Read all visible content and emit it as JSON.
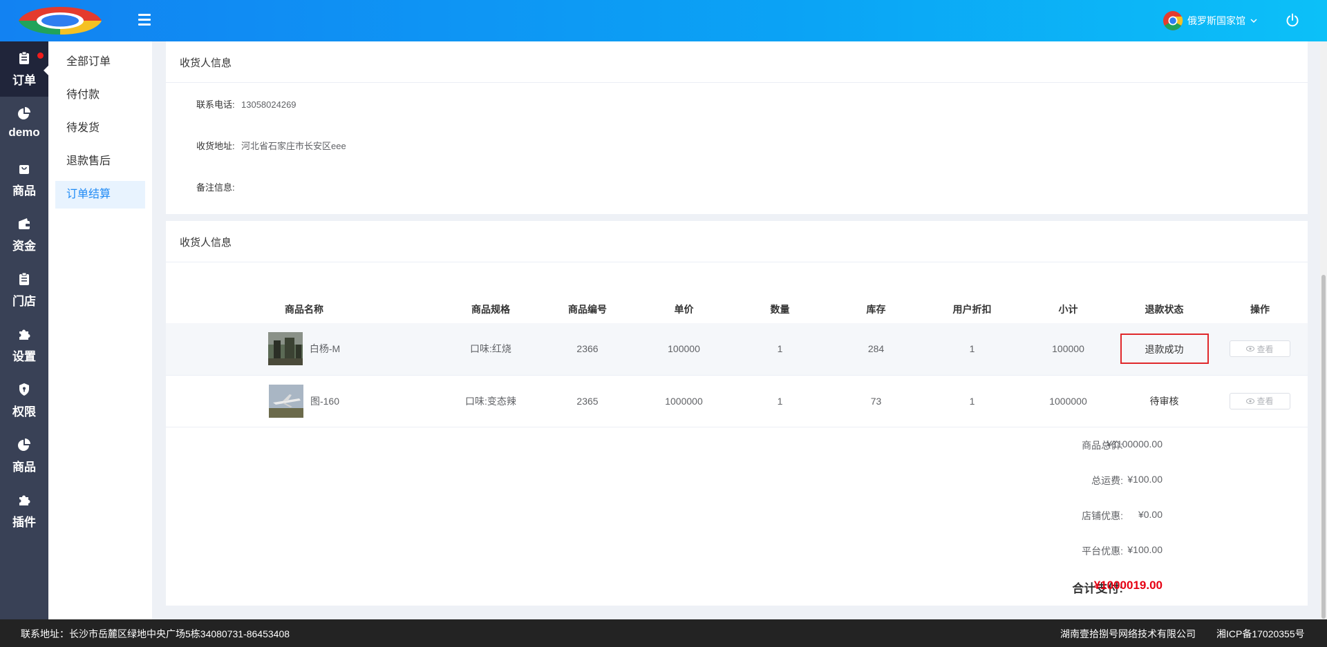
{
  "header": {
    "user_name": "俄罗斯国家馆"
  },
  "sidebar": {
    "items": [
      {
        "label": "订单",
        "icon": "clipboard-icon"
      },
      {
        "label": "demo",
        "icon": "pie-chart-icon"
      },
      {
        "label": "商品",
        "icon": "shopping-bag-icon"
      },
      {
        "label": "资金",
        "icon": "wallet-icon"
      },
      {
        "label": "门店",
        "icon": "clipboard-icon"
      },
      {
        "label": "设置",
        "icon": "puzzle-icon"
      },
      {
        "label": "权限",
        "icon": "shield-icon"
      },
      {
        "label": "商品",
        "icon": "pie-chart-icon"
      },
      {
        "label": "插件",
        "icon": "puzzle-icon"
      }
    ]
  },
  "submenu": {
    "items": [
      "全部订单",
      "待付款",
      "待发货",
      "退款售后",
      "订单结算"
    ]
  },
  "receiver": {
    "title": "收货人信息",
    "phone_label": "联系电话:",
    "phone": "13058024269",
    "address_label": "收货地址:",
    "address": "河北省石家庄市长安区eee",
    "remark_label": "备注信息:"
  },
  "goods": {
    "title": "收货人信息",
    "columns": [
      "商品名称",
      "商品规格",
      "商品编号",
      "单价",
      "数量",
      "库存",
      "用户折扣",
      "小计",
      "退款状态",
      "操作"
    ],
    "rows": [
      {
        "name": "白杨-M",
        "spec": "口味:红烧",
        "code": "2366",
        "price": "100000",
        "qty": "1",
        "stock": "284",
        "discount": "1",
        "subtotal": "100000",
        "status": "退款成功",
        "action": "查看"
      },
      {
        "name": "图-160",
        "spec": "口味:变态辣",
        "code": "2365",
        "price": "1000000",
        "qty": "1",
        "stock": "73",
        "discount": "1",
        "subtotal": "1000000",
        "status": "待审核",
        "action": "查看"
      }
    ]
  },
  "summary": {
    "total_label": "商品总价:",
    "total": "¥1100000.00",
    "shipping_label": "总运费:",
    "shipping": "¥100.00",
    "store_label": "店铺优惠:",
    "store": "¥0.00",
    "platform_label": "平台优惠:",
    "platform": "¥100.00",
    "pay_label": "合计支付:",
    "pay": "¥1000019.00"
  },
  "footer": {
    "address": "联系地址：长沙市岳麓区绿地中央广场5栋34080731-86453408",
    "company": "湖南壹拾捌号网络技术有限公司",
    "icp": "湘ICP备17020355号"
  },
  "colors": {
    "header_start": "#1282f2",
    "header_end": "#0cc0f8",
    "sidebar": "#394156",
    "active_menu": "#1e8af5",
    "pay_red": "#e60012",
    "status_border": "#e0272a"
  }
}
